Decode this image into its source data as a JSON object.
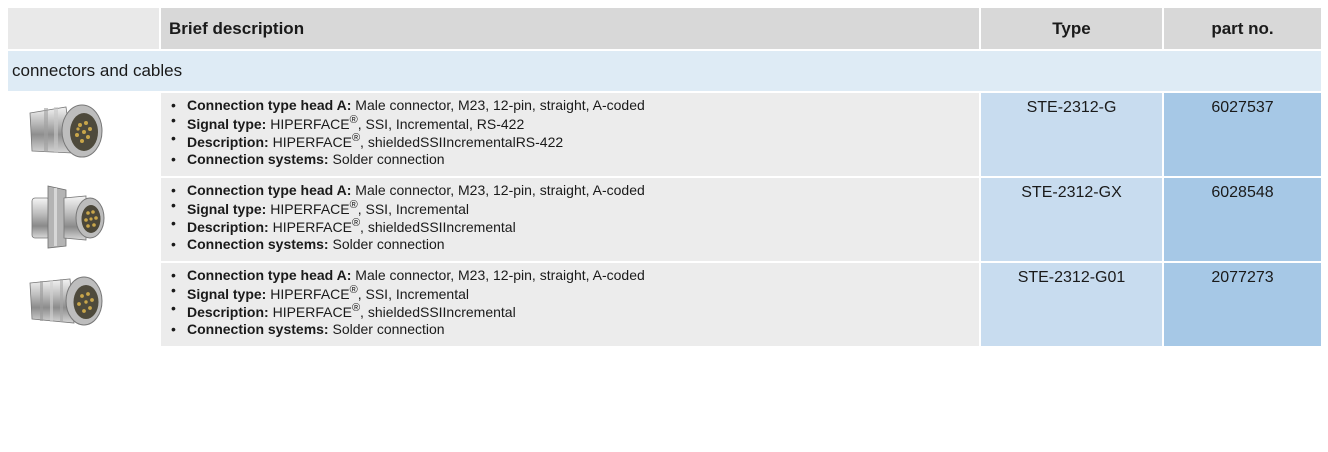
{
  "header": {
    "brief_description": "Brief description",
    "type": "Type",
    "part_no": "part no."
  },
  "group": {
    "title": "connectors and cables"
  },
  "products": [
    {
      "image_icon": "connector-straight-icon",
      "connection_label": "Connection type head A:",
      "connection_value": "Male connector, M23, 12-pin, straight, A-coded",
      "signal_label": "Signal type:",
      "signal_brand": "HIPERFACE",
      "signal_reg": "®",
      "signal_rest": ", SSI, Incremental, RS-422",
      "description_label": "Description:",
      "description_brand": "HIPERFACE",
      "description_reg": "®",
      "description_rest": ", shieldedSSIIncrementalRS-422",
      "systems_label": "Connection systems:",
      "systems_value": "Solder connection",
      "type": "STE-2312-G",
      "part_no": "6027537"
    },
    {
      "image_icon": "connector-flange-icon",
      "connection_label": "Connection type head A:",
      "connection_value": "Male connector, M23, 12-pin, straight, A-coded",
      "signal_label": "Signal type:",
      "signal_brand": "HIPERFACE",
      "signal_reg": "®",
      "signal_rest": ", SSI, Incremental",
      "description_label": "Description:",
      "description_brand": "HIPERFACE",
      "description_reg": "®",
      "description_rest": ", shieldedSSIIncremental",
      "systems_label": "Connection systems:",
      "systems_value": "Solder connection",
      "type": "STE-2312-GX",
      "part_no": "6028548"
    },
    {
      "image_icon": "connector-straight-icon",
      "connection_label": "Connection type head A:",
      "connection_value": "Male connector, M23, 12-pin, straight, A-coded",
      "signal_label": "Signal type:",
      "signal_brand": "HIPERFACE",
      "signal_reg": "®",
      "signal_rest": ", SSI, Incremental",
      "description_label": "Description:",
      "description_brand": "HIPERFACE",
      "description_reg": "®",
      "description_rest": ", shieldedSSIIncremental",
      "systems_label": "Connection systems:",
      "systems_value": "Solder connection",
      "type": "STE-2312-G01",
      "part_no": "2077273"
    }
  ]
}
